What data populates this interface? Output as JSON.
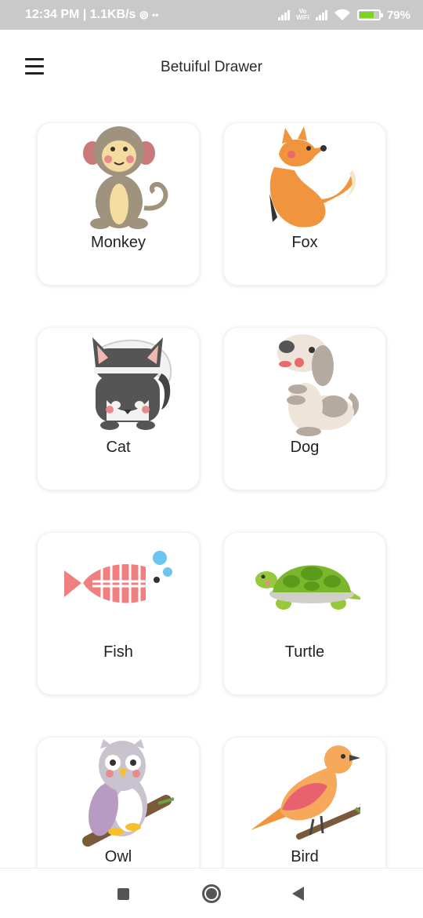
{
  "status_bar": {
    "time_speed": "12:34 PM | 1.1KB/s",
    "vowifi_top": "Vo",
    "vowifi_bottom": "WiFi",
    "battery": "79%"
  },
  "app_bar": {
    "title": "Betuiful Drawer",
    "menu_icon": "hamburger-menu-icon"
  },
  "animals": [
    {
      "label": "Monkey",
      "icon": "monkey-icon"
    },
    {
      "label": "Fox",
      "icon": "fox-icon"
    },
    {
      "label": "Cat",
      "icon": "cat-icon"
    },
    {
      "label": "Dog",
      "icon": "dog-icon"
    },
    {
      "label": "Fish",
      "icon": "fish-icon"
    },
    {
      "label": "Turtle",
      "icon": "turtle-icon"
    },
    {
      "label": "Owl",
      "icon": "owl-icon"
    },
    {
      "label": "Bird",
      "icon": "bird-icon"
    }
  ],
  "nav_bar": {
    "recents_icon": "square-icon",
    "home_icon": "circle-icon",
    "back_icon": "back-triangle-icon"
  },
  "colors": {
    "status_bar_bg": "#c9c9c9",
    "battery_fill": "#7ed321",
    "card_bg": "#ffffff",
    "nav_icon": "#555555"
  }
}
